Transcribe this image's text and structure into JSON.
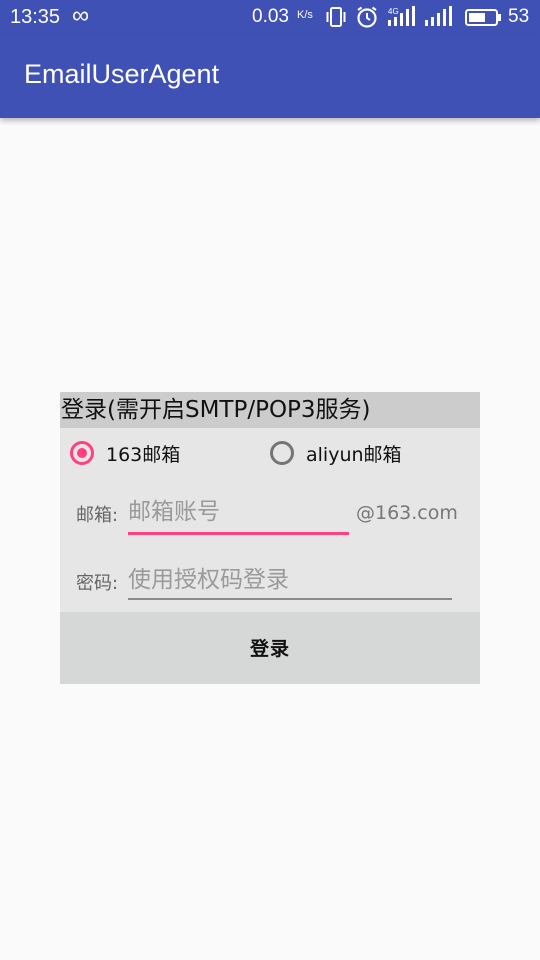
{
  "status_bar": {
    "time": "13:35",
    "net_speed": "0.03",
    "net_speed_unit": "K/s",
    "network_type": "4G",
    "battery_level": "53",
    "icons": [
      "infinity-icon",
      "vibrate-icon",
      "alarm-icon",
      "signal-4g-icon",
      "signal-icon",
      "battery-icon"
    ]
  },
  "app_bar": {
    "title": "EmailUserAgent",
    "color": "#3f51b5"
  },
  "login": {
    "header": "登录(需开启SMTP/POP3服务)",
    "providers": [
      {
        "label": "163邮箱",
        "selected": true
      },
      {
        "label": "aliyun邮箱",
        "selected": false
      }
    ],
    "email_label": "邮箱:",
    "email_placeholder": "邮箱账号",
    "email_value": "",
    "email_suffix": "@163.com",
    "password_label": "密码:",
    "password_placeholder": "使用授权码登录",
    "password_value": "",
    "submit_label": "登录",
    "accent_color": "#ff4081"
  }
}
